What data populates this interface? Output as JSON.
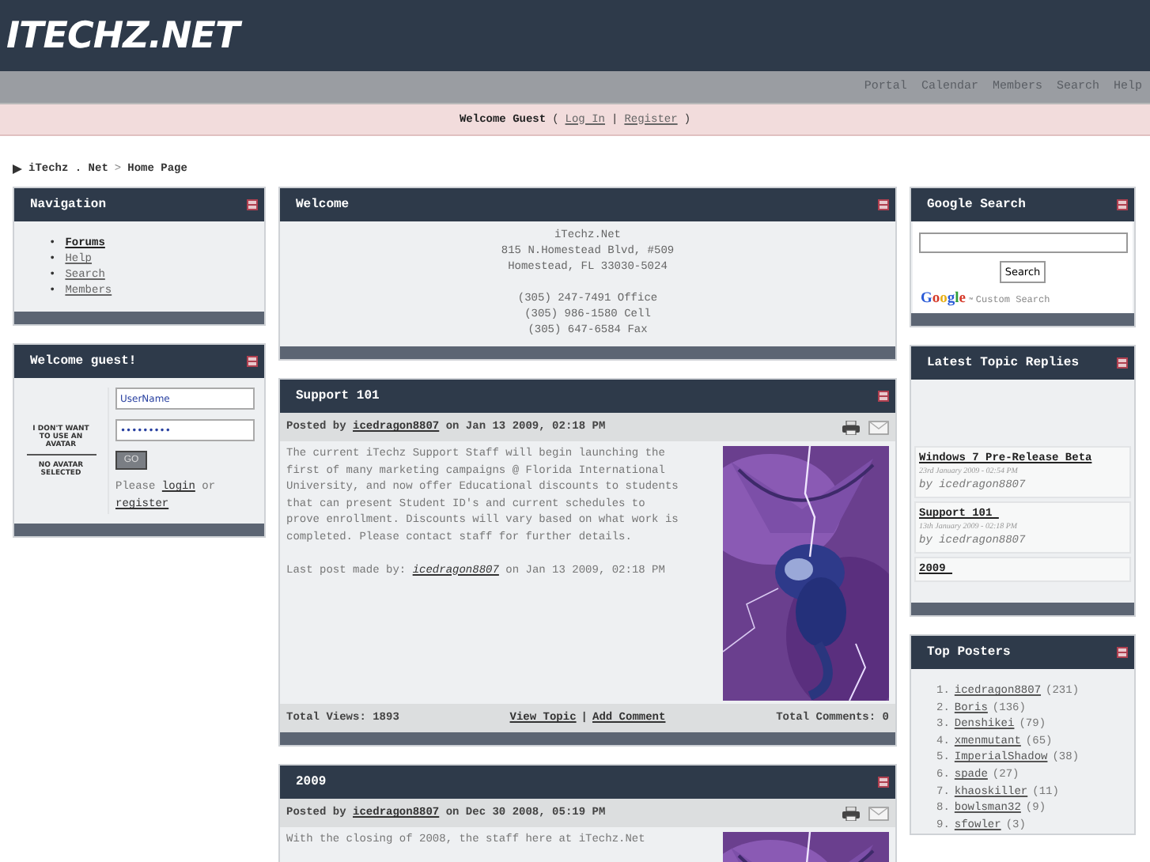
{
  "header": {
    "logo": "ITECHZ.NET"
  },
  "nav_links": [
    "Portal",
    "Calendar",
    "Members",
    "Search",
    "Help"
  ],
  "welcome_bar": {
    "greeting": "Welcome Guest",
    "open": "(",
    "login": "Log In",
    "separator": "|",
    "register": "Register",
    "close": ")"
  },
  "breadcrumb": [
    "iTechz . Net",
    ">",
    "Home Page"
  ],
  "navigation": {
    "title": "Navigation",
    "bullet": "•",
    "items": [
      {
        "label": "Forums",
        "selected": true
      },
      {
        "label": "Help",
        "selected": false
      },
      {
        "label": "Search",
        "selected": false
      },
      {
        "label": "Members",
        "selected": false
      }
    ]
  },
  "login": {
    "title": "Welcome guest!",
    "avatar_note": "I DON'T WANT TO USE AN AVATAR",
    "avatar_status": "NO AVATAR SELECTED",
    "username": "UserName",
    "password": "•••••••••",
    "button": "GO",
    "prompt": "Please",
    "login_link": "login",
    "or": "or",
    "register_link": "register"
  },
  "welcome": {
    "title": "Welcome",
    "address": [
      "iTechz.Net",
      "815 N.Homestead Blvd, #509",
      "Homestead, FL 33030-5024"
    ],
    "phones": [
      "(305) 247-7491 Office",
      "(305) 986-1580 Cell",
      "(305) 647-6584 Fax"
    ]
  },
  "posts": [
    {
      "title": "Support 101",
      "posted_by": "Posted by",
      "author": "icedragon8807",
      "date": "on Jan 13 2009, 02:18 PM",
      "body": "The current iTechz Support Staff will begin launching the first of many marketing campaigns @ Florida International University, and now offer Educational discounts to students that can present Student ID's and current schedules to prove enrollment. Discounts will vary based on what work is completed. Please contact staff for further details.",
      "last_post": {
        "prefix": "Last post made by:",
        "author": "icedragon8807",
        "date": "on Jan 13 2009, 02:18 PM"
      },
      "views": "Total Views: 1893",
      "view_topic": "View Topic",
      "separator": "|",
      "add_comment": "Add Comment",
      "comments": "Total Comments: 0"
    },
    {
      "title": "2009",
      "posted_by": "Posted by",
      "author": "icedragon8807",
      "date": "on Dec 30 2008, 05:19 PM",
      "body": "With the closing of 2008, the staff here at iTechz.Net"
    }
  ],
  "google_search": {
    "title": "Google Search",
    "button": "Search",
    "logo": "Google",
    "trademark": "™",
    "caption": "Custom Search"
  },
  "latest_replies": {
    "title": "Latest Topic Replies",
    "items": [
      {
        "title": "Windows 7 Pre-Release Beta",
        "date": "23rd January 2009 - 02:54 PM",
        "by": "by icedragon8807"
      },
      {
        "title": "Support 101 ",
        "date": "13th January 2009 - 02:18 PM",
        "by": "by icedragon8807"
      },
      {
        "title": "2009 "
      }
    ]
  },
  "top_posters": {
    "title": "Top Posters",
    "items": [
      {
        "rank": "1.",
        "name": "icedragon8807",
        "count": "(231)"
      },
      {
        "rank": "2.",
        "name": "Boris",
        "count": "(136)"
      },
      {
        "rank": "3.",
        "name": "Denshikei",
        "count": "(79)"
      },
      {
        "rank": "4.",
        "name": "xmenmutant",
        "count": "(65)"
      },
      {
        "rank": "5.",
        "name": "ImperialShadow",
        "count": "(38)"
      },
      {
        "rank": "6.",
        "name": "spade",
        "count": "(27)"
      },
      {
        "rank": "7.",
        "name": "khaoskiller",
        "count": "(11)"
      },
      {
        "rank": "8.",
        "name": "bowlsman32",
        "count": "(9)"
      },
      {
        "rank": "9.",
        "name": "sfowler",
        "count": "(3)"
      }
    ]
  }
}
